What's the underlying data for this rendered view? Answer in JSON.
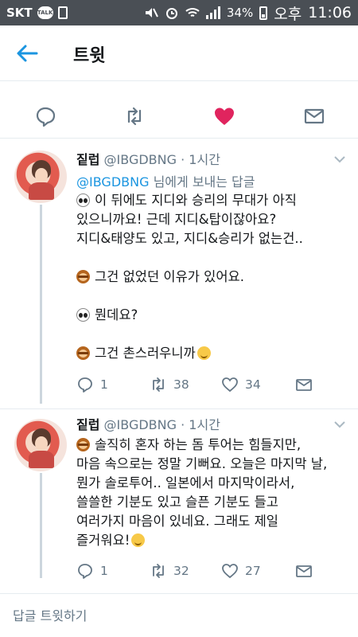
{
  "status_bar": {
    "carrier": "SKT",
    "talk_badge": "TALK",
    "battery": "34%",
    "time_period": "오후",
    "time": "11:06"
  },
  "header": {
    "title": "트윗",
    "back_icon": "arrow-left-icon"
  },
  "actions_row": {
    "icons": [
      "reply-icon",
      "retweet-icon",
      "like-icon",
      "dm-icon"
    ],
    "like_color": "#e0245e"
  },
  "tweets": [
    {
      "name": "짙럽",
      "handle": "@IBGDBNG",
      "time": "· 1시간",
      "reply_handle": "@IBGDBNG",
      "reply_suffix": " 님에게 보내는 답글",
      "lines": [
        "이 뒤에도 지디와 승리의 무대가 아직",
        "있으니까요! 근데 지디&탑이잖아요?",
        "지디&태양도 있고, 지디&승리가 없는건..",
        "그건 없었던 이유가 있어요.",
        "뭔데요?",
        "그건 촌스러우니까"
      ],
      "replies": "1",
      "retweets": "38",
      "likes": "34"
    },
    {
      "name": "짙럽",
      "handle": "@IBGDBNG",
      "time": "· 1시간",
      "lines": [
        "솔직히 혼자 하는 돔 투어는 힘들지만,",
        "마음 속으로는 정말 기뻐요. 오늘은 마지막 날,",
        "뭔가 솔로투어.. 일본에서 마지막이라서,",
        "쓸쓸한 기분도 있고 슬픈 기분도 들고",
        "여러가지 마음이 있네요. 그래도 제일",
        "즐거워요!"
      ],
      "replies": "1",
      "retweets": "32",
      "likes": "27"
    }
  ],
  "reply_bar": {
    "placeholder": "답글 트윗하기"
  },
  "colors": {
    "accent": "#1b95e0",
    "muted": "#657786",
    "status_bar": "#4a4f55"
  }
}
